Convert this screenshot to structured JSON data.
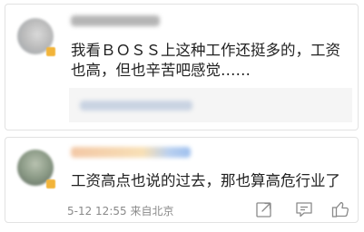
{
  "comments": [
    {
      "text": "我看ＢＯＳＳ上这种工作还挺多的，工资也高，但也辛苦吧感觉……"
    },
    {
      "text": "工资高点也说的过去，那也算高危行业了",
      "meta": "5-12 12:55 来自北京"
    }
  ],
  "icons": {
    "share": "share-icon",
    "comment": "comment-icon",
    "like": "thumbs-up-icon"
  },
  "colors": {
    "text": "#222222",
    "meta": "#8a8a8a",
    "border": "#e2e2e2",
    "reply_bg": "#f5f5f5",
    "badge": "#f2b43a"
  }
}
